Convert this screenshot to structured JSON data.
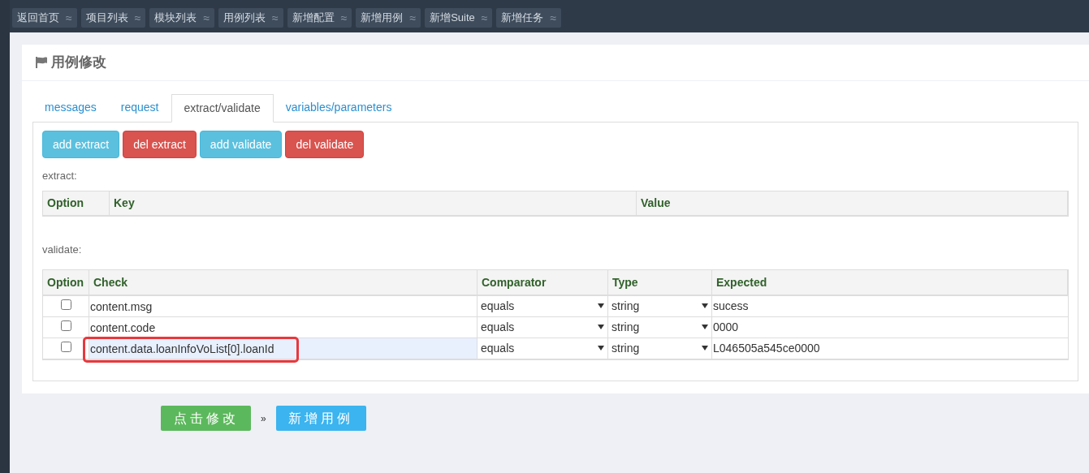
{
  "nav": [
    {
      "label": "返回首页",
      "tilde": "≈"
    },
    {
      "label": "项目列表",
      "tilde": "≈"
    },
    {
      "label": "模块列表",
      "tilde": "≈"
    },
    {
      "label": "用例列表",
      "tilde": "≈"
    },
    {
      "label": "新增配置",
      "tilde": "≈"
    },
    {
      "label": "新增用例",
      "tilde": "≈"
    },
    {
      "label": "新增Suite",
      "tilde": "≈"
    },
    {
      "label": "新增任务",
      "tilde": "≈"
    }
  ],
  "title": "用例修改",
  "tabs": [
    {
      "label": "messages",
      "selected": false
    },
    {
      "label": "request",
      "selected": false
    },
    {
      "label": "extract/validate",
      "selected": true
    },
    {
      "label": "variables/parameters",
      "selected": false
    }
  ],
  "actions": [
    {
      "label": "add extract",
      "kind": "info"
    },
    {
      "label": "del extract",
      "kind": "danger"
    },
    {
      "label": "add validate",
      "kind": "info"
    },
    {
      "label": "del validate",
      "kind": "danger"
    }
  ],
  "extract": {
    "label": "extract:",
    "columns": [
      "Option",
      "Key",
      "Value"
    ]
  },
  "validate": {
    "label": "validate:",
    "columns": [
      "Option",
      "Check",
      "Comparator",
      "Type",
      "Expected"
    ],
    "rows": [
      {
        "checked": false,
        "check": "content.msg",
        "comparator": "equals",
        "type": "string",
        "expected": "sucess",
        "highlighted": false
      },
      {
        "checked": false,
        "check": "content.code",
        "comparator": "equals",
        "type": "string",
        "expected": "0000",
        "highlighted": false
      },
      {
        "checked": false,
        "check": "content.data.loanInfoVoList[0].loanId",
        "comparator": "equals",
        "type": "string",
        "expected": "L046505a545ce0000",
        "highlighted": true
      }
    ]
  },
  "footer": {
    "submit": "点击修改",
    "separator": "»",
    "add": "新增用例"
  }
}
